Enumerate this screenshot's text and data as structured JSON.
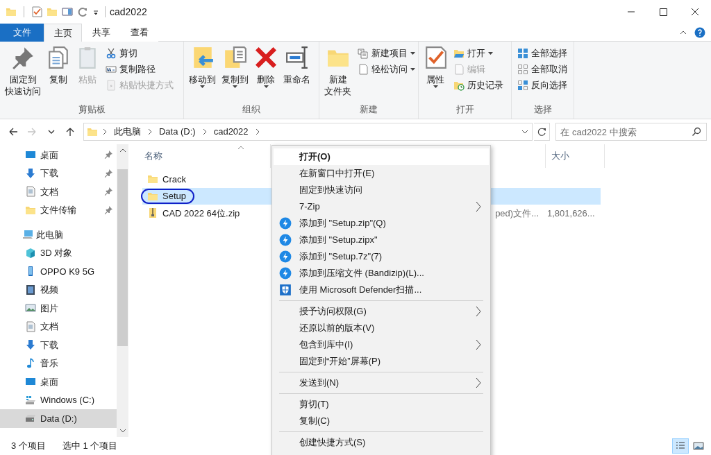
{
  "window": {
    "title": "cad2022"
  },
  "ribbon_tabs": [
    {
      "label": "文件",
      "kind": "file",
      "selected": false
    },
    {
      "label": "主页",
      "kind": "tab",
      "selected": true
    },
    {
      "label": "共享",
      "kind": "tab",
      "selected": false
    },
    {
      "label": "查看",
      "kind": "tab",
      "selected": false
    }
  ],
  "ribbon_groups": [
    {
      "label": "剪贴板",
      "items": [
        {
          "lines": [
            "固定到",
            "快速访问"
          ],
          "kind": "large",
          "disabled": false,
          "dropdown": false
        },
        {
          "lines": [
            "复制"
          ],
          "kind": "large",
          "disabled": false,
          "dropdown": false
        },
        {
          "lines": [
            "粘贴"
          ],
          "kind": "large",
          "disabled": true,
          "dropdown": false
        },
        {
          "lines": [
            "剪切"
          ],
          "kind": "small",
          "disabled": false,
          "dropdown": false
        },
        {
          "lines": [
            "复制路径"
          ],
          "kind": "small",
          "disabled": false,
          "dropdown": false
        },
        {
          "lines": [
            "粘贴快捷方式"
          ],
          "kind": "small",
          "disabled": true,
          "dropdown": false
        }
      ]
    },
    {
      "label": "组织",
      "items": [
        {
          "lines": [
            "移动到"
          ],
          "kind": "large",
          "disabled": false,
          "dropdown": true
        },
        {
          "lines": [
            "复制到"
          ],
          "kind": "large",
          "disabled": false,
          "dropdown": true
        },
        {
          "lines": [
            "删除"
          ],
          "kind": "large",
          "disabled": false,
          "dropdown": true
        },
        {
          "lines": [
            "重命名"
          ],
          "kind": "large",
          "disabled": false,
          "dropdown": false
        }
      ]
    },
    {
      "label": "新建",
      "items": [
        {
          "lines": [
            "新建",
            "文件夹"
          ],
          "kind": "large",
          "disabled": false,
          "dropdown": false
        },
        {
          "lines": [
            "新建项目"
          ],
          "kind": "small",
          "disabled": false,
          "dropdown": true
        },
        {
          "lines": [
            "轻松访问"
          ],
          "kind": "small",
          "disabled": false,
          "dropdown": true
        }
      ]
    },
    {
      "label": "打开",
      "items": [
        {
          "lines": [
            "属性"
          ],
          "kind": "large",
          "disabled": false,
          "dropdown": true
        },
        {
          "lines": [
            "打开"
          ],
          "kind": "small",
          "disabled": false,
          "dropdown": true
        },
        {
          "lines": [
            "编辑"
          ],
          "kind": "small",
          "disabled": true,
          "dropdown": false
        },
        {
          "lines": [
            "历史记录"
          ],
          "kind": "small",
          "disabled": false,
          "dropdown": false
        }
      ]
    },
    {
      "label": "选择",
      "items": [
        {
          "lines": [
            "全部选择"
          ],
          "kind": "small",
          "disabled": false,
          "dropdown": false
        },
        {
          "lines": [
            "全部取消"
          ],
          "kind": "small",
          "disabled": false,
          "dropdown": false
        },
        {
          "lines": [
            "反向选择"
          ],
          "kind": "small",
          "disabled": false,
          "dropdown": false
        }
      ]
    }
  ],
  "nav_buttons": [
    {
      "kind": "back",
      "disabled": false
    },
    {
      "kind": "forward",
      "disabled": true
    },
    {
      "kind": "recent",
      "disabled": false
    },
    {
      "kind": "up",
      "disabled": false
    }
  ],
  "address": {
    "crumbs": [
      "此电脑",
      "Data (D:)",
      "cad2022"
    ]
  },
  "search": {
    "placeholder": "在 cad2022 中搜索"
  },
  "sidebar": {
    "quick_access": [
      {
        "label": "桌面",
        "pinned": true
      },
      {
        "label": "下载",
        "pinned": true
      },
      {
        "label": "文档",
        "pinned": true
      },
      {
        "label": "文件传输",
        "pinned": true
      }
    ],
    "this_pc": {
      "label": "此电脑",
      "children": [
        {
          "label": "3D 对象",
          "selected": false
        },
        {
          "label": "OPPO K9 5G",
          "selected": false
        },
        {
          "label": "视频",
          "selected": false
        },
        {
          "label": "图片",
          "selected": false
        },
        {
          "label": "文档",
          "selected": false
        },
        {
          "label": "下载",
          "selected": false
        },
        {
          "label": "音乐",
          "selected": false
        },
        {
          "label": "桌面",
          "selected": false
        },
        {
          "label": "Windows (C:)",
          "selected": false
        },
        {
          "label": "Data (D:)",
          "selected": true
        }
      ]
    }
  },
  "file_list": {
    "columns": [
      {
        "label": "名称",
        "sorted": true
      },
      {
        "label": "大小",
        "sorted": false
      }
    ],
    "rows": [
      {
        "name": "Crack",
        "kind": "folder",
        "selected": false,
        "circled": false
      },
      {
        "name": "Setup",
        "kind": "folder",
        "selected": true,
        "circled": true
      },
      {
        "name": "CAD 2022 64位.zip",
        "kind": "zip",
        "selected": false,
        "circled": false,
        "type": "ped)文件...",
        "size": "1,801,626..."
      }
    ]
  },
  "context_menu": {
    "items": [
      {
        "kind": "item",
        "label": "打开(O)",
        "bold": true,
        "highlighted": true,
        "submenu": false
      },
      {
        "kind": "item",
        "label": "在新窗口中打开(E)",
        "bold": false,
        "highlighted": false,
        "submenu": false
      },
      {
        "kind": "item",
        "label": "固定到快速访问",
        "bold": false,
        "highlighted": false,
        "submenu": false
      },
      {
        "kind": "item",
        "label": "7-Zip",
        "bold": false,
        "highlighted": false,
        "submenu": true
      },
      {
        "kind": "bandizip",
        "label": "添加到 \"Setup.zip\"(Q)",
        "bold": false,
        "highlighted": false,
        "submenu": false
      },
      {
        "kind": "bandizip",
        "label": "添加到 \"Setup.zipx\"",
        "bold": false,
        "highlighted": false,
        "submenu": false
      },
      {
        "kind": "bandizip",
        "label": "添加到 \"Setup.7z\"(7)",
        "bold": false,
        "highlighted": false,
        "submenu": false
      },
      {
        "kind": "bandizip",
        "label": "添加到压缩文件 (Bandizip)(L)...",
        "bold": false,
        "highlighted": false,
        "submenu": false
      },
      {
        "kind": "defender",
        "label": "使用 Microsoft Defender扫描...",
        "bold": false,
        "highlighted": false,
        "submenu": false
      },
      {
        "kind": "separator"
      },
      {
        "kind": "item",
        "label": "授予访问权限(G)",
        "bold": false,
        "highlighted": false,
        "submenu": true
      },
      {
        "kind": "item",
        "label": "还原以前的版本(V)",
        "bold": false,
        "highlighted": false,
        "submenu": false
      },
      {
        "kind": "item",
        "label": "包含到库中(I)",
        "bold": false,
        "highlighted": false,
        "submenu": true
      },
      {
        "kind": "item",
        "label": "固定到“开始”屏幕(P)",
        "bold": false,
        "highlighted": false,
        "submenu": false
      },
      {
        "kind": "separator"
      },
      {
        "kind": "item",
        "label": "发送到(N)",
        "bold": false,
        "highlighted": false,
        "submenu": true
      },
      {
        "kind": "separator"
      },
      {
        "kind": "item",
        "label": "剪切(T)",
        "bold": false,
        "highlighted": false,
        "submenu": false
      },
      {
        "kind": "item",
        "label": "复制(C)",
        "bold": false,
        "highlighted": false,
        "submenu": false
      },
      {
        "kind": "separator"
      },
      {
        "kind": "item",
        "label": "创建快捷方式(S)",
        "bold": false,
        "highlighted": false,
        "submenu": false
      }
    ]
  },
  "status_bar": {
    "item_count": "3 个项目",
    "selection": "选中 1 个项目",
    "views": [
      {
        "kind": "details",
        "selected": true
      },
      {
        "kind": "thumbnails",
        "selected": false
      }
    ]
  }
}
